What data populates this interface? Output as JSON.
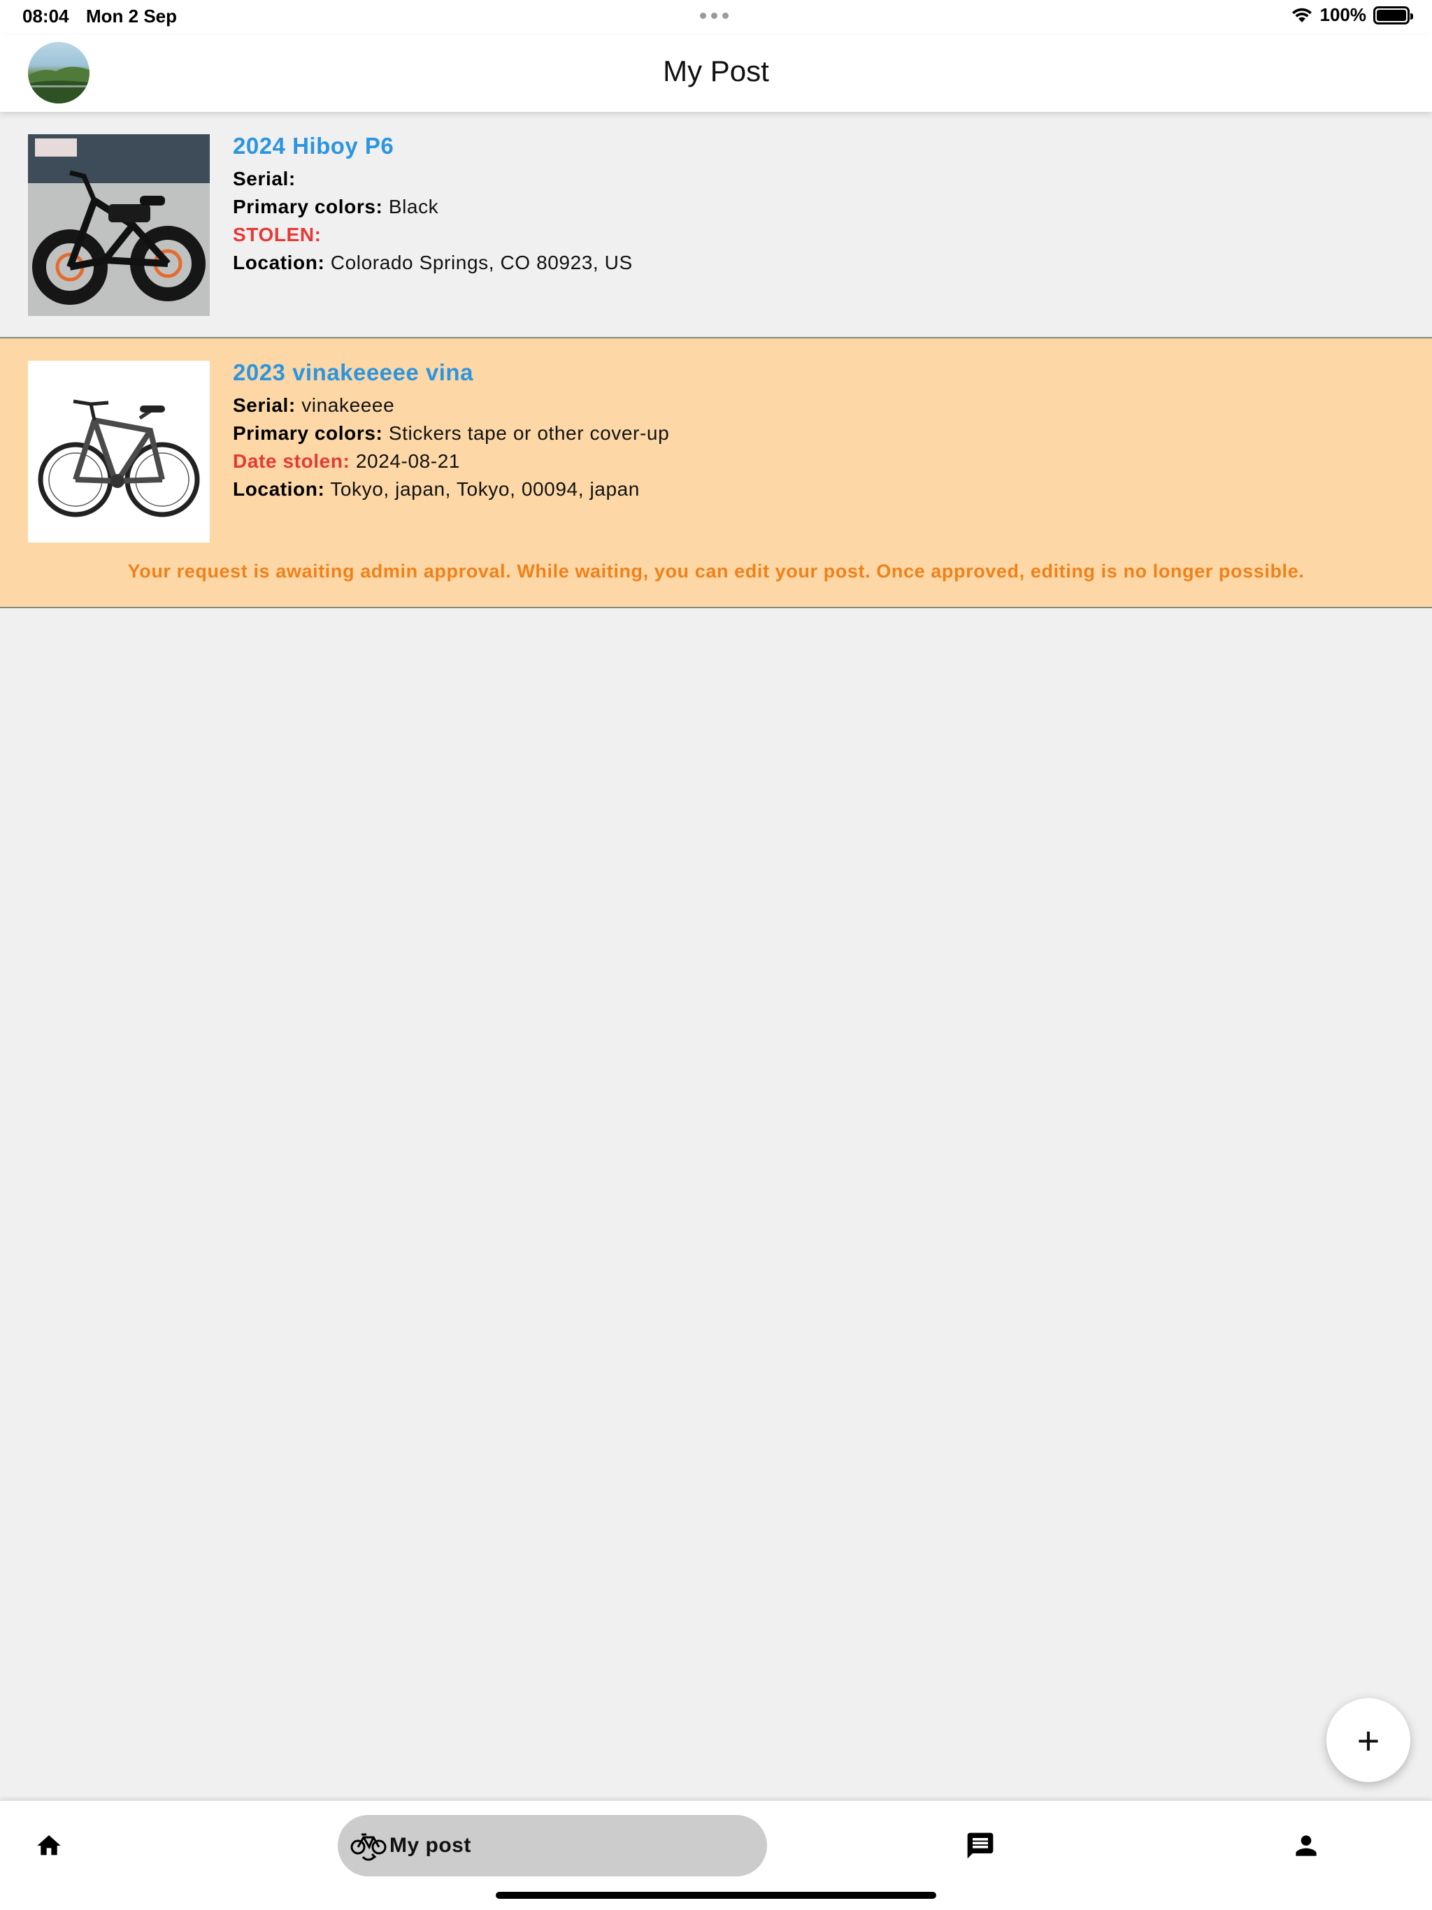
{
  "status_bar": {
    "time": "08:04",
    "date": "Mon 2 Sep",
    "battery": "100%"
  },
  "header": {
    "title": "My Post"
  },
  "posts": [
    {
      "title": "2024 Hiboy P6",
      "serial_label": "Serial:",
      "serial": "",
      "colors_label": "Primary colors:",
      "colors": "Black",
      "stolen_label": "STOLEN:",
      "stolen": "",
      "location_label": "Location:",
      "location": "Colorado Springs, CO 80923, US"
    },
    {
      "title": "2023 vinakeeeee vina",
      "serial_label": "Serial:",
      "serial": "vinakeeee",
      "colors_label": "Primary colors:",
      "colors": "Stickers tape or other cover-up",
      "stolen_label": "Date stolen:",
      "stolen": "2024-08-21",
      "location_label": "Location:",
      "location": "Tokyo, japan, Tokyo, 00094, japan",
      "notice": "Your request is awaiting admin approval. While waiting, you can edit your post. Once approved, editing is no longer possible."
    }
  ],
  "fab": {
    "symbol": "+"
  },
  "tab_bar": {
    "items": [
      {
        "icon": "home-icon",
        "label": ""
      },
      {
        "icon": "bike-sync-icon",
        "label": "My post"
      },
      {
        "icon": "chat-icon",
        "label": ""
      },
      {
        "icon": "person-icon",
        "label": ""
      }
    ]
  },
  "colors": {
    "accent_blue": "#2d95df",
    "stolen_red": "#e53935",
    "pending_bg": "#fdd8a6",
    "pending_text": "#f0811a"
  }
}
